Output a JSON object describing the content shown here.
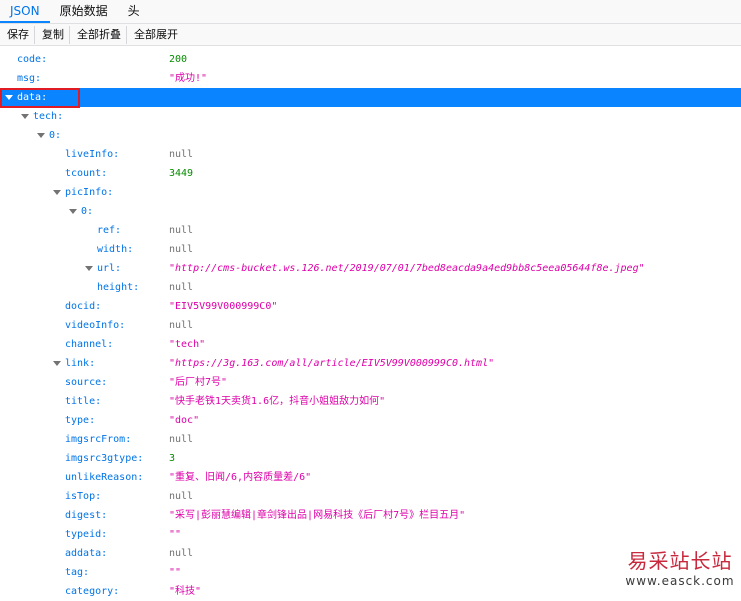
{
  "tabs": [
    {
      "label": "JSON",
      "active": true
    },
    {
      "label": "原始数据",
      "active": false
    },
    {
      "label": "头",
      "active": false
    }
  ],
  "toolbar": {
    "save": "保存",
    "copy": "复制",
    "collapse_all": "全部折叠",
    "expand_all": "全部展开"
  },
  "rows": [
    {
      "key": "code:",
      "depth": 0,
      "value": "200",
      "type": "num"
    },
    {
      "key": "msg:",
      "depth": 0,
      "value": "\"成功!\"",
      "type": "str"
    },
    {
      "key": "data:",
      "depth": 0,
      "expander": true,
      "selected": true
    },
    {
      "key": "tech:",
      "depth": 1,
      "expander": true
    },
    {
      "key": "0:",
      "depth": 2,
      "expander": true
    },
    {
      "key": "liveInfo:",
      "depth": 3,
      "value": "null",
      "type": "nul"
    },
    {
      "key": "tcount:",
      "depth": 3,
      "value": "3449",
      "type": "num"
    },
    {
      "key": "picInfo:",
      "depth": 3,
      "expander": true
    },
    {
      "key": "0:",
      "depth": 4,
      "expander": true
    },
    {
      "key": "ref:",
      "depth": 5,
      "value": "null",
      "type": "nul"
    },
    {
      "key": "width:",
      "depth": 5,
      "value": "null",
      "type": "nul"
    },
    {
      "key": "url:",
      "depth": 5,
      "expander": true,
      "value": "\"http://cms-bucket.ws.126.net/2019/07/01/7bed8eacda9a4ed9bb8c5eea05644f8e.jpeg\"",
      "type": "url"
    },
    {
      "key": "height:",
      "depth": 5,
      "value": "null",
      "type": "nul"
    },
    {
      "key": "docid:",
      "depth": 3,
      "value": "\"EIV5V99V000999C0\"",
      "type": "str"
    },
    {
      "key": "videoInfo:",
      "depth": 3,
      "value": "null",
      "type": "nul"
    },
    {
      "key": "channel:",
      "depth": 3,
      "value": "\"tech\"",
      "type": "str"
    },
    {
      "key": "link:",
      "depth": 3,
      "expander": true,
      "value": "\"https://3g.163.com/all/article/EIV5V99V000999C0.html\"",
      "type": "url"
    },
    {
      "key": "source:",
      "depth": 3,
      "value": "\"后厂村7号\"",
      "type": "str"
    },
    {
      "key": "title:",
      "depth": 3,
      "value": "\"快手老铁1天卖货1.6亿，抖音小姐姐敌力如何\"",
      "type": "str"
    },
    {
      "key": "type:",
      "depth": 3,
      "value": "\"doc\"",
      "type": "str"
    },
    {
      "key": "imgsrcFrom:",
      "depth": 3,
      "value": "null",
      "type": "nul"
    },
    {
      "key": "imgsrc3gtype:",
      "depth": 3,
      "value": "3",
      "type": "num"
    },
    {
      "key": "unlikeReason:",
      "depth": 3,
      "value": "\"重复、旧闻/6,内容质量差/6\"",
      "type": "str"
    },
    {
      "key": "isTop:",
      "depth": 3,
      "value": "null",
      "type": "nul"
    },
    {
      "key": "digest:",
      "depth": 3,
      "value": "\"采写|彭丽慧编辑|章剑锋出品|网易科技《后厂村7号》栏目五月\"",
      "type": "str"
    },
    {
      "key": "typeid:",
      "depth": 3,
      "value": "\"\"",
      "type": "str"
    },
    {
      "key": "addata:",
      "depth": 3,
      "value": "null",
      "type": "nul"
    },
    {
      "key": "tag:",
      "depth": 3,
      "value": "\"\"",
      "type": "str"
    },
    {
      "key": "category:",
      "depth": 3,
      "value": "\"科技\"",
      "type": "str"
    }
  ],
  "watermark": {
    "cn": "易采站长站",
    "url": "www.easck.com"
  },
  "colors": {
    "accent": "#0a84ff",
    "key": "#0074e8",
    "string": "#dd00a9",
    "number": "#058b00",
    "null": "#737373",
    "highlight_box": "#e01b24"
  }
}
